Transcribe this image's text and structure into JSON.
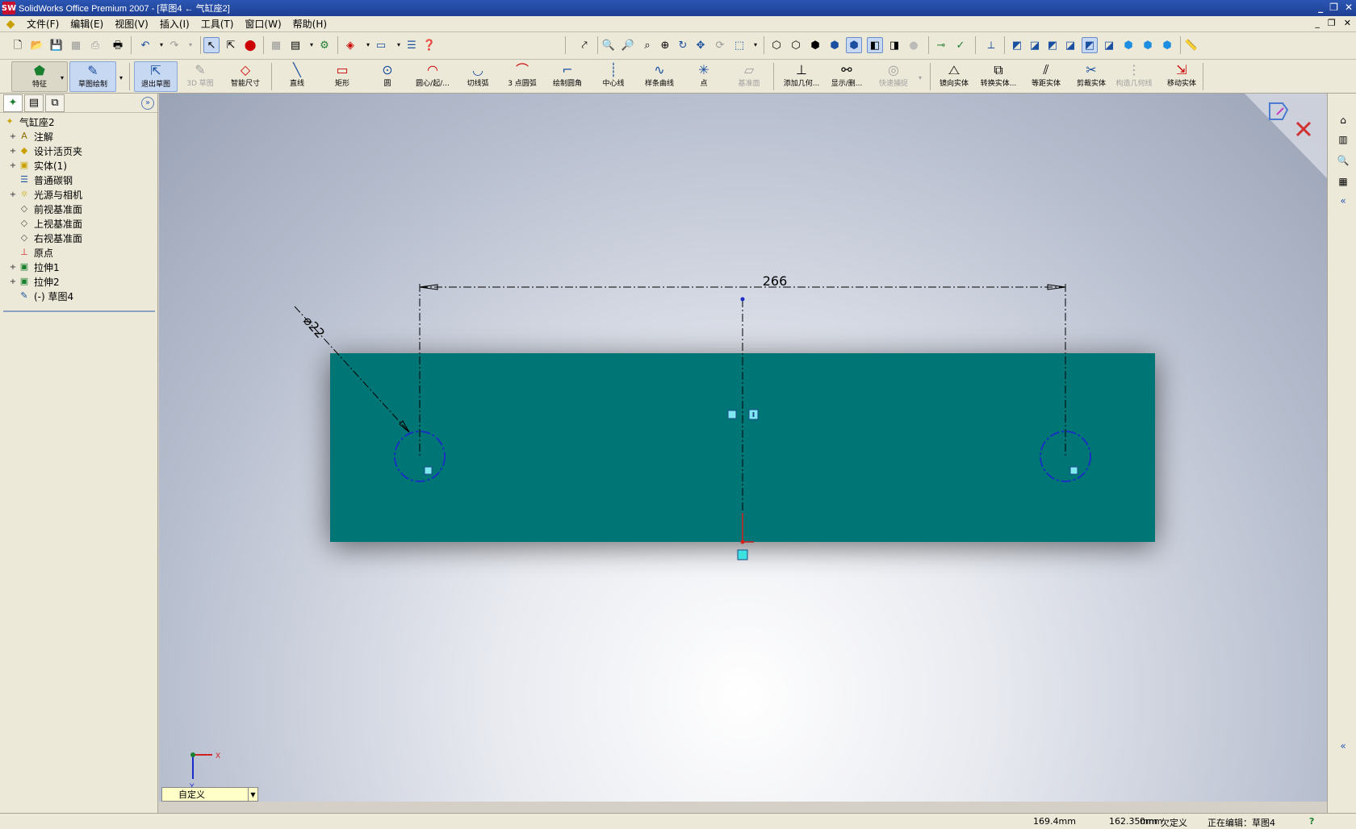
{
  "window": {
    "title": "SolidWorks Office Premium 2007 - [草图4 ← 气缸座2]",
    "app_icon": "SW",
    "controls": [
      "_",
      "❐",
      "✕"
    ]
  },
  "menu": {
    "items": [
      "文件(F)",
      "编辑(E)",
      "视图(V)",
      "插入(I)",
      "工具(T)",
      "窗口(W)",
      "帮助(H)"
    ],
    "mdi_controls": [
      "_",
      "❐",
      "✕"
    ]
  },
  "command_manager": {
    "buttons": [
      {
        "label": "特征",
        "icon": "feature-icon"
      },
      {
        "label": "草图绘制",
        "icon": "sketch-icon"
      },
      {
        "label": "退出草图",
        "icon": "exit-sketch-icon"
      },
      {
        "label": "3D 草图",
        "icon": "3d-sketch-icon"
      },
      {
        "label": "智能尺寸",
        "icon": "smart-dimension-icon"
      },
      {
        "label": "直线",
        "icon": "line-icon"
      },
      {
        "label": "矩形",
        "icon": "rectangle-icon"
      },
      {
        "label": "圆",
        "icon": "circle-icon"
      },
      {
        "label": "圆心/起/...",
        "icon": "centerpoint-arc-icon"
      },
      {
        "label": "切线弧",
        "icon": "tangent-arc-icon"
      },
      {
        "label": "3 点圆弧",
        "icon": "three-point-arc-icon"
      },
      {
        "label": "绘制圆角",
        "icon": "sketch-fillet-icon"
      },
      {
        "label": "中心线",
        "icon": "centerline-icon"
      },
      {
        "label": "样条曲线",
        "icon": "spline-icon"
      },
      {
        "label": "点",
        "icon": "point-icon"
      },
      {
        "label": "基准面",
        "icon": "plane-icon"
      },
      {
        "label": "添加几何...",
        "icon": "add-relation-icon"
      },
      {
        "label": "显示/删...",
        "icon": "display-delete-relations-icon"
      },
      {
        "label": "快速捕捉",
        "icon": "quick-snaps-icon"
      },
      {
        "label": "镜向实体",
        "icon": "mirror-entities-icon"
      },
      {
        "label": "转换实体...",
        "icon": "convert-entities-icon"
      },
      {
        "label": "等距实体",
        "icon": "offset-entities-icon"
      },
      {
        "label": "剪裁实体",
        "icon": "trim-entities-icon"
      },
      {
        "label": "构造几何线",
        "icon": "construction-geometry-icon"
      },
      {
        "label": "移动实体",
        "icon": "move-entities-icon"
      }
    ]
  },
  "feature_tree": {
    "items": [
      {
        "label": "气缸座2",
        "icon": "part-icon",
        "expandable": false,
        "indent": 0
      },
      {
        "label": "注解",
        "icon": "annotations-icon",
        "expandable": true,
        "indent": 1
      },
      {
        "label": "设计活页夹",
        "icon": "design-binder-icon",
        "expandable": true,
        "indent": 1
      },
      {
        "label": "实体(1)",
        "icon": "solid-bodies-icon",
        "expandable": true,
        "indent": 1
      },
      {
        "label": "普通碳钢",
        "icon": "material-icon",
        "expandable": false,
        "indent": 1
      },
      {
        "label": "光源与相机",
        "icon": "lights-cameras-icon",
        "expandable": true,
        "indent": 1
      },
      {
        "label": "前视基准面",
        "icon": "plane-icon",
        "expandable": false,
        "indent": 1
      },
      {
        "label": "上视基准面",
        "icon": "plane-icon",
        "expandable": false,
        "indent": 1
      },
      {
        "label": "右视基准面",
        "icon": "plane-icon",
        "expandable": false,
        "indent": 1
      },
      {
        "label": "原点",
        "icon": "origin-icon",
        "expandable": false,
        "indent": 1
      },
      {
        "label": "拉伸1",
        "icon": "extrude-icon",
        "expandable": true,
        "indent": 1
      },
      {
        "label": "拉伸2",
        "icon": "extrude-icon",
        "expandable": true,
        "indent": 1
      },
      {
        "label": "(-) 草图4",
        "icon": "sketch-icon",
        "expandable": false,
        "indent": 1
      }
    ]
  },
  "sketch": {
    "horizontal_dimension": "266",
    "diameter_dimension": "⌀22",
    "plate_color": "#007475"
  },
  "view_orientation": {
    "value": "自定义"
  },
  "triad": {
    "x": "X",
    "y": "Y"
  },
  "status": {
    "x_coord": "169.4mm",
    "y_coord": "162.35mm",
    "z_coord": "0mm",
    "state": "欠定义",
    "editing": "正在编辑：草图4",
    "help": "?"
  }
}
